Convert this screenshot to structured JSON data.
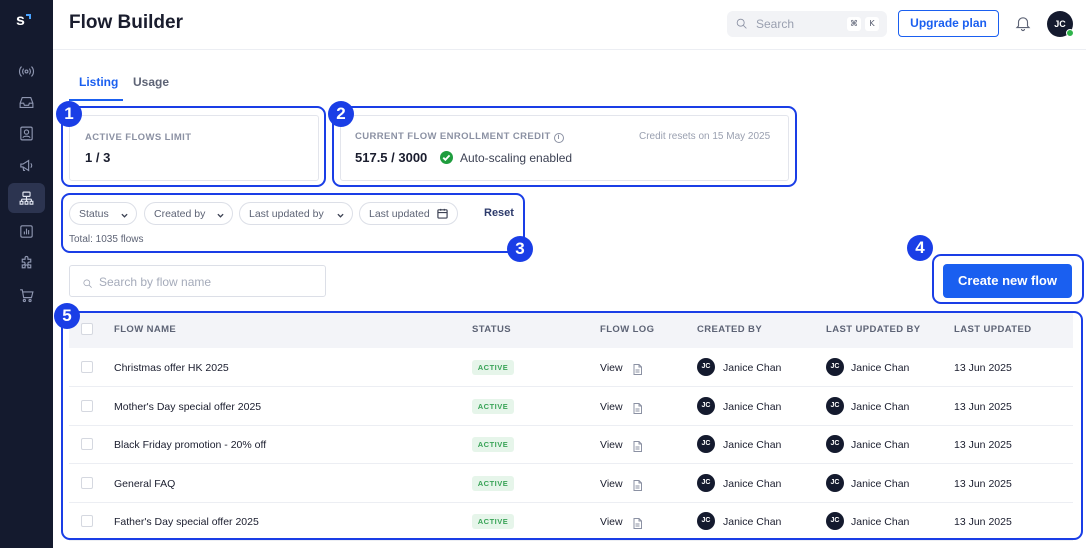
{
  "app": {
    "logo_text": "S",
    "page_title": "Flow Builder"
  },
  "sidebar": {
    "items": [
      {
        "icon": "broadcast-icon",
        "active": false
      },
      {
        "icon": "inbox-icon",
        "active": false
      },
      {
        "icon": "contact-card-icon",
        "active": false
      },
      {
        "icon": "megaphone-icon",
        "active": false
      },
      {
        "icon": "flow-builder-icon",
        "active": true
      },
      {
        "icon": "analytics-icon",
        "active": false
      },
      {
        "icon": "integrations-icon",
        "active": false
      },
      {
        "icon": "cart-icon",
        "active": false
      }
    ]
  },
  "header": {
    "search_placeholder": "Search",
    "shortcut_keys": [
      "⌘",
      "K"
    ],
    "upgrade_label": "Upgrade plan",
    "avatar_initials": "JC"
  },
  "tabs": [
    {
      "label": "Listing",
      "active": true
    },
    {
      "label": "Usage",
      "active": false
    }
  ],
  "active_flows": {
    "label": "ACTIVE FLOWS LIMIT",
    "value": "1 / 3"
  },
  "enrollment_credit": {
    "label": "CURRENT FLOW ENROLLMENT CREDIT",
    "value": "517.5 / 3000",
    "status": "Auto-scaling enabled",
    "reset_note": "Credit resets on 15 May 2025"
  },
  "filters": {
    "status": "Status",
    "created_by": "Created by",
    "last_updated_by": "Last updated by",
    "last_updated": "Last updated",
    "reset": "Reset",
    "total": "Total: 1035 flows"
  },
  "flow_search": {
    "placeholder": "Search by flow name"
  },
  "create_button": "Create new flow",
  "table": {
    "columns": [
      "FLOW NAME",
      "STATUS",
      "FLOW LOG",
      "CREATED BY",
      "LAST UPDATED BY",
      "LAST UPDATED"
    ],
    "rows": [
      {
        "name": "Christmas offer HK 2025",
        "status": "ACTIVE",
        "log": "View",
        "created_initials": "JC",
        "created_by": "Janice Chan",
        "updated_initials": "JC",
        "updated_by": "Janice Chan",
        "updated": "13 Jun 2025"
      },
      {
        "name": "Mother's Day special offer 2025",
        "status": "ACTIVE",
        "log": "View",
        "created_initials": "JC",
        "created_by": "Janice Chan",
        "updated_initials": "JC",
        "updated_by": "Janice Chan",
        "updated": "13 Jun 2025"
      },
      {
        "name": "Black Friday promotion - 20% off",
        "status": "ACTIVE",
        "log": "View",
        "created_initials": "JC",
        "created_by": "Janice Chan",
        "updated_initials": "JC",
        "updated_by": "Janice Chan",
        "updated": "13 Jun 2025"
      },
      {
        "name": "General FAQ",
        "status": "ACTIVE",
        "log": "View",
        "created_initials": "JC",
        "created_by": "Janice Chan",
        "updated_initials": "JC",
        "updated_by": "Janice Chan",
        "updated": "13 Jun 2025"
      },
      {
        "name": "Father's Day special offer 2025",
        "status": "ACTIVE",
        "log": "View",
        "created_initials": "JC",
        "created_by": "Janice Chan",
        "updated_initials": "JC",
        "updated_by": "Janice Chan",
        "updated": "13 Jun 2025"
      }
    ]
  },
  "annotations": [
    "1",
    "2",
    "3",
    "4",
    "5"
  ],
  "colors": {
    "accent": "#1a5ff0",
    "annotation": "#1a3ee6",
    "sidebar": "#141a2e",
    "active_badge_bg": "#e6f5ea",
    "active_badge_text": "#3aa458"
  }
}
